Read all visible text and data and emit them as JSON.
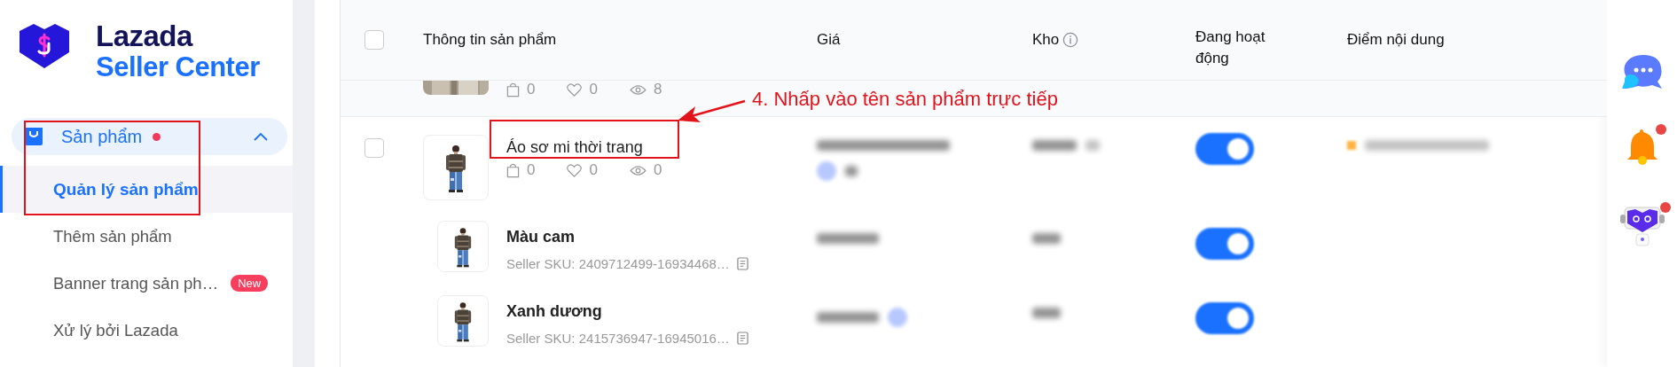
{
  "sidebar": {
    "logo": {
      "line_1": "Lazada",
      "line_2": "Seller Center"
    },
    "menu": [
      {
        "label": "Sản phẩm",
        "expanded": true,
        "dot": true,
        "children": [
          {
            "label": "Quản lý sản phẩm",
            "selected": true
          },
          {
            "label": "Thêm sản phẩm",
            "selected": false
          },
          {
            "label": "Banner trang sản ph…",
            "selected": false,
            "badge": "New"
          },
          {
            "label": "Xử lý bởi Lazada",
            "selected": false
          }
        ]
      }
    ]
  },
  "table": {
    "select_all": {
      "checked": false
    },
    "columns": [
      {
        "label": "Thông tin sản phẩm"
      },
      {
        "label": "Giá"
      },
      {
        "label": "Kho",
        "info": true
      },
      {
        "label": "Đang hoạt động"
      },
      {
        "label": "Điểm nội dung"
      }
    ],
    "rows": [
      {
        "kind": "partial",
        "stats": {
          "orders": "0",
          "likes": "0",
          "views": "8"
        }
      },
      {
        "kind": "product",
        "checked": false,
        "name": "Áo sơ mi thời trang",
        "stats": {
          "orders": "0",
          "likes": "0",
          "views": "0"
        },
        "active": {
          "on": true
        },
        "variants": [
          {
            "name": "Màu cam",
            "sku": "Seller SKU: 2409712499-16934468…",
            "on": true
          },
          {
            "name": "Xanh dương",
            "sku": "Seller SKU: 2415736947-16945016…",
            "on": true
          }
        ]
      }
    ]
  },
  "annotation": {
    "text": "4. Nhấp vào tên sản phẩm trực tiếp"
  },
  "right_rail": [
    {
      "kind": "chat",
      "dot": false
    },
    {
      "kind": "bell",
      "dot": true
    },
    {
      "kind": "robot",
      "dot": true
    }
  ]
}
